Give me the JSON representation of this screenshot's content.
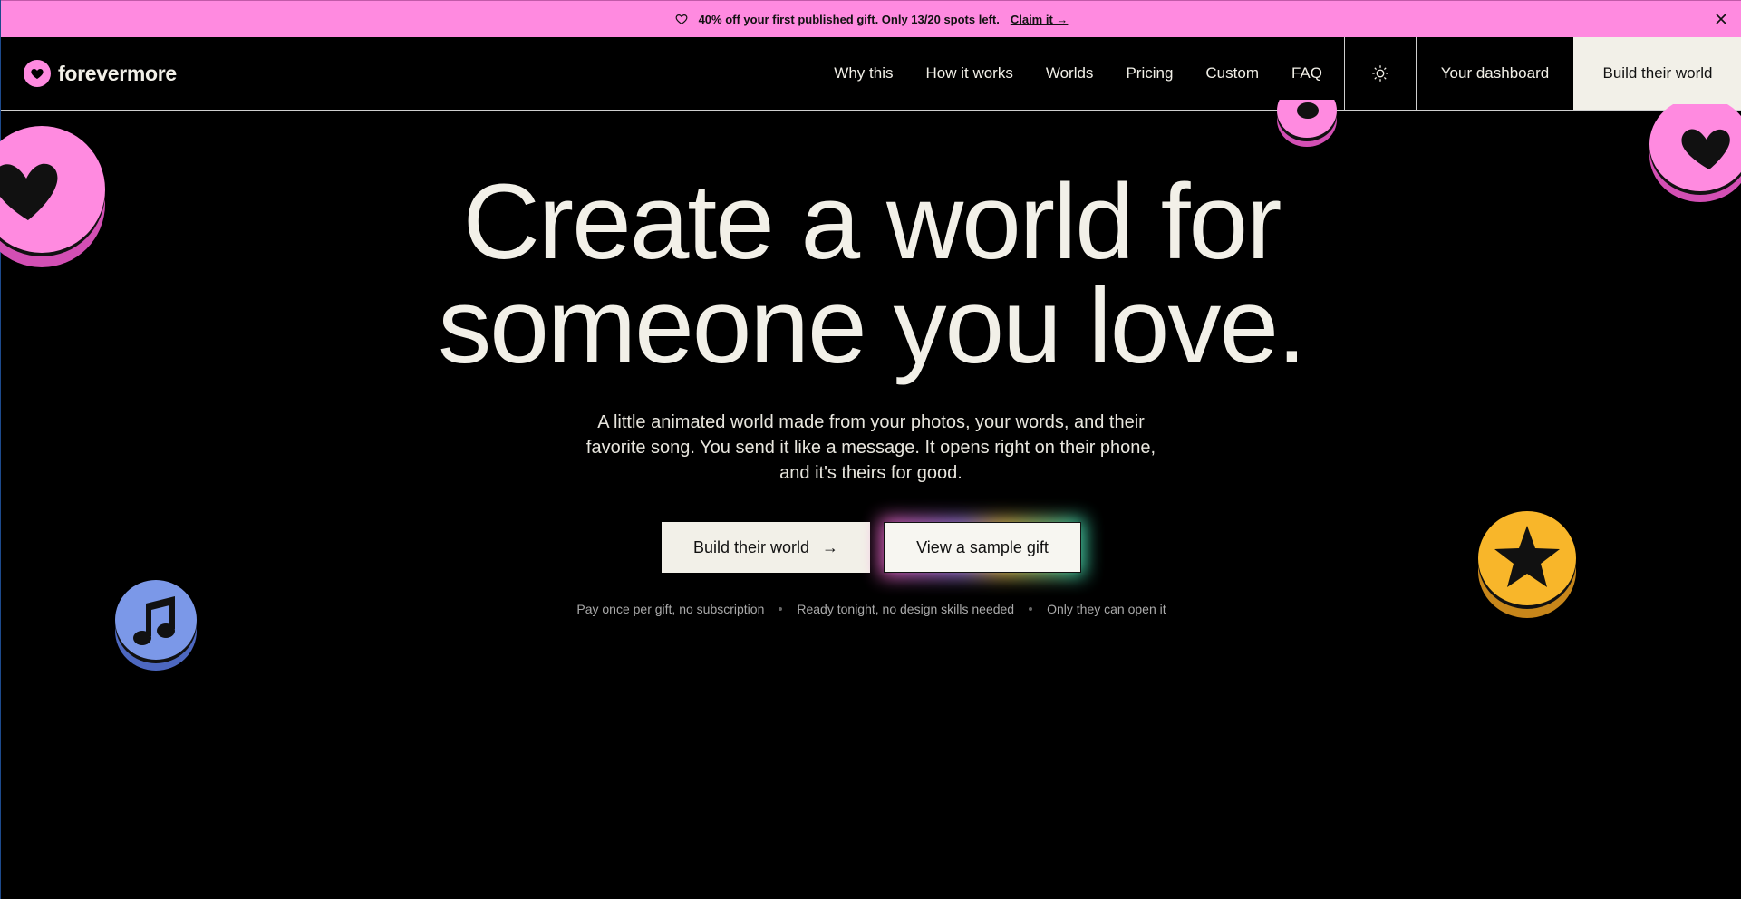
{
  "banner": {
    "message": "40% off your first published gift. Only 13/20 spots left.",
    "claim_label": "Claim it →",
    "close_icon": "×",
    "bg_color": "#ff8ae0"
  },
  "header": {
    "logo_text": "forevermore",
    "nav_items": [
      {
        "label": "Why this"
      },
      {
        "label": "How it works"
      },
      {
        "label": "Worlds"
      },
      {
        "label": "Pricing"
      },
      {
        "label": "Custom"
      },
      {
        "label": "FAQ"
      }
    ],
    "theme_toggle_icon": "sun-icon",
    "dashboard_label": "Your dashboard",
    "build_label": "Build their world"
  },
  "hero": {
    "title_line1": "Create a world for",
    "title_line2": "someone you love.",
    "subtitle": "A little animated world made from your photos, your words, and their favorite song. You send it like a message. It opens right on their phone, and it's theirs for good.",
    "primary_cta": "Build their world",
    "primary_cta_arrow": "→",
    "secondary_cta": "View a sample gift",
    "perks": [
      "Pay once per gift, no subscription",
      "Ready tonight, no design skills needed",
      "Only they can open it"
    ]
  },
  "decor": {
    "pink": "#ff8ae0",
    "pink_dark": "#d34fb4",
    "blue": "#7b98e8",
    "blue_dark": "#4d68c0",
    "yellow": "#f8b62a",
    "yellow_dark": "#c7861a"
  }
}
